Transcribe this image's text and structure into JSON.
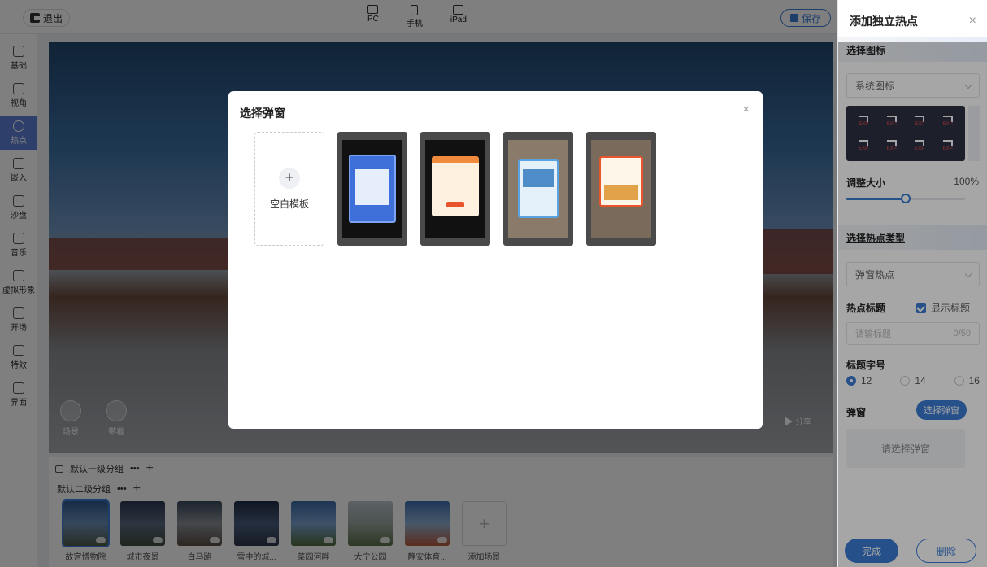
{
  "topbar": {
    "exit_label": "退出",
    "devices": [
      {
        "label": "PC"
      },
      {
        "label": "手机"
      },
      {
        "label": "iPad"
      }
    ],
    "save_label": "保存"
  },
  "sidebar": {
    "items": [
      {
        "label": "基础",
        "icon": "layers-icon"
      },
      {
        "label": "视角",
        "icon": "view-icon"
      },
      {
        "label": "热点",
        "icon": "hotspot-icon",
        "active": true
      },
      {
        "label": "嵌入",
        "icon": "embed-icon"
      },
      {
        "label": "沙盘",
        "icon": "sandbox-icon"
      },
      {
        "label": "音乐",
        "icon": "music-icon"
      },
      {
        "label": "虚拟形象",
        "icon": "avatar-icon"
      },
      {
        "label": "开场",
        "icon": "opening-icon"
      },
      {
        "label": "特效",
        "icon": "effects-icon"
      },
      {
        "label": "界面",
        "icon": "interface-icon"
      }
    ]
  },
  "pano": {
    "buttons": [
      {
        "label": "场景",
        "icon": "scene-icon"
      },
      {
        "label": "带看",
        "icon": "guide-icon"
      }
    ],
    "share_label": "分享"
  },
  "scenes": {
    "group_level1": "默认一级分组",
    "group_level2": "默认二级分组",
    "more": "•••",
    "plus": "+",
    "items": [
      {
        "name": "故宫博物院"
      },
      {
        "name": "城市夜景"
      },
      {
        "name": "白马路"
      },
      {
        "name": "雪中的城..."
      },
      {
        "name": "菜园河畔"
      },
      {
        "name": "大宁公园"
      },
      {
        "name": "静安体育..."
      }
    ],
    "add_label": "添加场景"
  },
  "modal": {
    "title": "选择弹窗",
    "close": "×",
    "blank_template_label": "空白模板",
    "plus": "+",
    "templates": [
      {
        "name": "template-1",
        "accent": "#3f6fd8"
      },
      {
        "name": "template-2",
        "accent": "#f08a3c"
      },
      {
        "name": "template-3",
        "accent": "#5aa2e0"
      },
      {
        "name": "template-4",
        "accent": "#e8542c"
      }
    ]
  },
  "right_panel": {
    "title": "添加独立热点",
    "close": "×",
    "choose_icon_title": "选择图标",
    "icon_source": "系统图标",
    "icon_tag": "EXP",
    "size_label": "调整大小",
    "size_value": "100%",
    "size_fraction": 0.5,
    "hotspot_type_title": "选择热点类型",
    "hotspot_type_value": "弹窗热点",
    "hotspot_title_label": "热点标题",
    "show_title_label": "显示标题",
    "title_placeholder": "请输标题",
    "title_count": "0/50",
    "font_size_label": "标题字号",
    "font_sizes": [
      {
        "value": "12",
        "selected": true
      },
      {
        "value": "14",
        "selected": false
      },
      {
        "value": "16",
        "selected": false
      }
    ],
    "popup_label": "弹窗",
    "pick_popup_label": "选择弹窗",
    "pick_popup_placeholder": "请选择弹窗",
    "done_label": "完成",
    "delete_label": "删除"
  },
  "colors": {
    "accent": "#3a7bd5",
    "sidebar_active": "#5e7fd6"
  }
}
